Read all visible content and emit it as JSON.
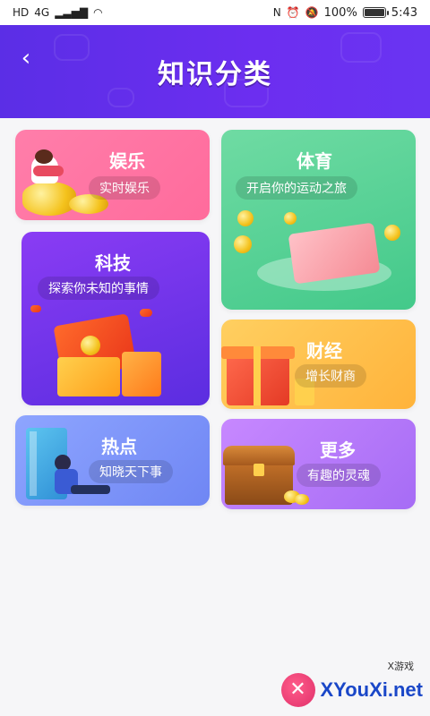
{
  "status_bar": {
    "left_icons": [
      "HD",
      "4G"
    ],
    "nfc": "N",
    "battery_percent": "100%",
    "battery_level": 1.0,
    "time": "5:43"
  },
  "header": {
    "title": "知识分类",
    "back_icon": "chevron-left-icon"
  },
  "categories": [
    {
      "title": "娱乐",
      "subtitle": "实时娱乐"
    },
    {
      "title": "体育",
      "subtitle": "开启你的运动之旅"
    },
    {
      "title": "科技",
      "subtitle": "探索你未知的事情"
    },
    {
      "title": "财经",
      "subtitle": "增长财商"
    },
    {
      "title": "热点",
      "subtitle": "知晓天下事"
    },
    {
      "title": "更多",
      "subtitle": "有趣的灵魂"
    }
  ],
  "watermark": {
    "small": "X游戏",
    "text": "XYouXi.net"
  },
  "colors": {
    "header": "#5b2ee6",
    "entertainment": "#ff7eaa",
    "sports": "#43c98a",
    "technology": "#6a33ea",
    "finance": "#ffb33b",
    "hot": "#7a90f8",
    "more": "#b477f8"
  }
}
